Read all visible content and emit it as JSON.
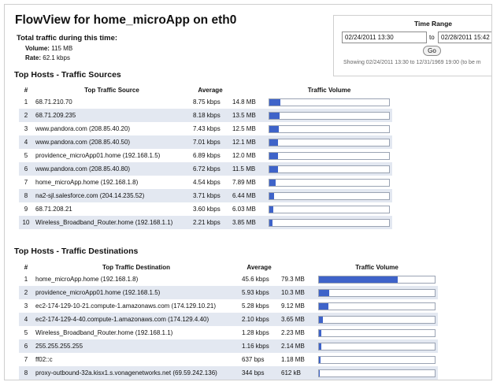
{
  "header": {
    "title": "FlowView for home_microApp on eth0",
    "total_label": "Total traffic during this time:",
    "volume_label": "Volume:",
    "volume_value": "115 MB",
    "rate_label": "Rate:",
    "rate_value": "62.1 kbps"
  },
  "time_range": {
    "title": "Time Range",
    "start_value": "02/24/2011 13:30",
    "to_label": "to",
    "end_value": "02/28/2011 15:42",
    "go_label": "Go",
    "showing_text": "Showing 02/24/2011 13:30 to 12/31/1969 19:00 (to be m"
  },
  "sources": {
    "title": "Top Hosts - Traffic Sources",
    "columns": [
      "#",
      "Top Traffic Source",
      "Average",
      "",
      "Traffic Volume"
    ],
    "rows": [
      {
        "n": "1",
        "host": "68.71.210.70",
        "avg": "8.75 kbps",
        "vol": "14.8 MB",
        "fraction": 0.09
      },
      {
        "n": "2",
        "host": "68.71.209.235",
        "avg": "8.18 kbps",
        "vol": "13.5 MB",
        "fraction": 0.085
      },
      {
        "n": "3",
        "host": "www.pandora.com (208.85.40.20)",
        "avg": "7.43 kbps",
        "vol": "12.5 MB",
        "fraction": 0.08
      },
      {
        "n": "4",
        "host": "www.pandora.com (208.85.40.50)",
        "avg": "7.01 kbps",
        "vol": "12.1 MB",
        "fraction": 0.075
      },
      {
        "n": "5",
        "host": "providence_microApp01.home (192.168.1.5)",
        "avg": "6.89 kbps",
        "vol": "12.0 MB",
        "fraction": 0.075
      },
      {
        "n": "6",
        "host": "www.pandora.com (208.85.40.80)",
        "avg": "6.72 kbps",
        "vol": "11.5 MB",
        "fraction": 0.07
      },
      {
        "n": "7",
        "host": "home_microApp.home (192.168.1.8)",
        "avg": "4.54 kbps",
        "vol": "7.89 MB",
        "fraction": 0.05
      },
      {
        "n": "8",
        "host": "na2-sjl.salesforce.com (204.14.235.52)",
        "avg": "3.71 kbps",
        "vol": "6.44 MB",
        "fraction": 0.04
      },
      {
        "n": "9",
        "host": "68.71.208.21",
        "avg": "3.60 kbps",
        "vol": "6.03 MB",
        "fraction": 0.035
      },
      {
        "n": "10",
        "host": "Wireless_Broadband_Router.home (192.168.1.1)",
        "avg": "2.21 kbps",
        "vol": "3.85 MB",
        "fraction": 0.025
      }
    ]
  },
  "destinations": {
    "title": "Top Hosts - Traffic Destinations",
    "columns": [
      "#",
      "Top Traffic Destination",
      "Average",
      "",
      "Traffic Volume"
    ],
    "rows": [
      {
        "n": "1",
        "host": "home_microApp.home (192.168.1.8)",
        "avg": "45.6 kbps",
        "vol": "79.3 MB",
        "fraction": 0.68
      },
      {
        "n": "2",
        "host": "providence_microApp01.home (192.168.1.5)",
        "avg": "5.93 kbps",
        "vol": "10.3 MB",
        "fraction": 0.09
      },
      {
        "n": "3",
        "host": "ec2-174-129-10-21.compute-1.amazonaws.com (174.129.10.21)",
        "avg": "5.28 kbps",
        "vol": "9.12 MB",
        "fraction": 0.08
      },
      {
        "n": "4",
        "host": "ec2-174-129-4-40.compute-1.amazonaws.com (174.129.4.40)",
        "avg": "2.10 kbps",
        "vol": "3.65 MB",
        "fraction": 0.035
      },
      {
        "n": "5",
        "host": "Wireless_Broadband_Router.home (192.168.1.1)",
        "avg": "1.28 kbps",
        "vol": "2.23 MB",
        "fraction": 0.02
      },
      {
        "n": "6",
        "host": "255.255.255.255",
        "avg": "1.16 kbps",
        "vol": "2.14 MB",
        "fraction": 0.02
      },
      {
        "n": "7",
        "host": "ff02::c",
        "avg": "637 bps",
        "vol": "1.18 MB",
        "fraction": 0.012
      },
      {
        "n": "8",
        "host": "proxy-outbound-32a.kisx1.s.vonagenetworks.net (69.59.242.136)",
        "avg": "344 bps",
        "vol": "612 kB",
        "fraction": 0.006
      }
    ]
  }
}
